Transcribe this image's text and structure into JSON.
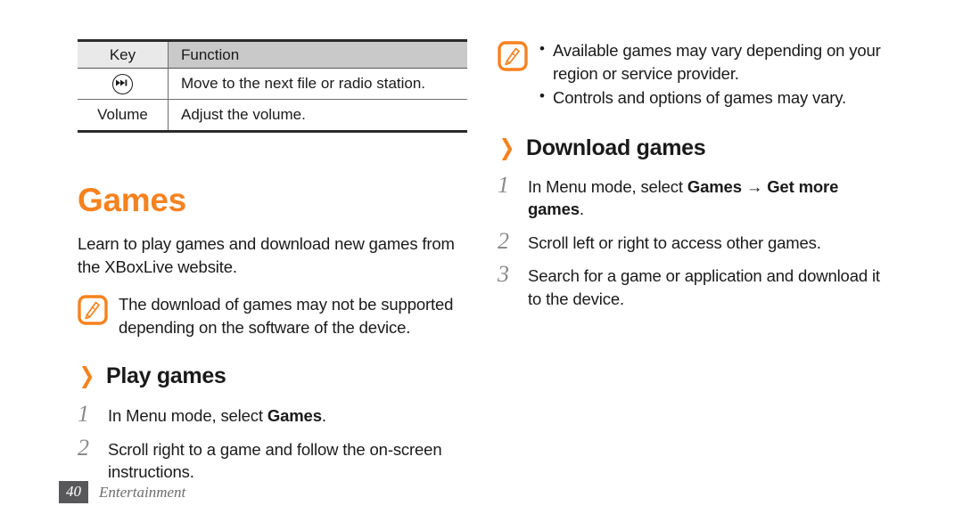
{
  "table": {
    "headers": [
      "Key",
      "Function"
    ],
    "rows": [
      {
        "key_icon": "next-track-icon",
        "key": "",
        "function": "Move to the next file or radio station."
      },
      {
        "key_icon": "",
        "key": "Volume",
        "function": "Adjust the volume."
      }
    ]
  },
  "left": {
    "title": "Games",
    "intro": "Learn to play games and download new games from the XBoxLive website.",
    "note": {
      "icon": "note-pen-icon",
      "text": "The download of games may not be supported depending on the software of the device."
    },
    "section": {
      "chevron": "❯",
      "heading": "Play games",
      "steps": [
        {
          "num": "1",
          "pre": "In Menu mode, select ",
          "bold": "Games",
          "post": "."
        },
        {
          "num": "2",
          "pre": "Scroll right to a game and follow the on-screen instructions.",
          "bold": "",
          "post": ""
        }
      ]
    }
  },
  "right": {
    "note": {
      "icon": "note-pen-icon",
      "bullets": [
        "Available games may vary depending on your region or service provider.",
        "Controls and options of games may vary."
      ]
    },
    "section": {
      "chevron": "❯",
      "heading": "Download games",
      "steps": [
        {
          "num": "1",
          "pre": "In Menu mode, select ",
          "bold": "Games",
          "mid": " → ",
          "bold2": "Get more games",
          "post": "."
        },
        {
          "num": "2",
          "pre": "Scroll left or right to access other games.",
          "bold": "",
          "post": ""
        },
        {
          "num": "3",
          "pre": "Search for a game or application and download it to the device.",
          "bold": "",
          "post": ""
        }
      ]
    }
  },
  "footer": {
    "page": "40",
    "label": "Entertainment"
  },
  "colors": {
    "accent_orange": "#F5821F",
    "header_key_bg": "#E9E9E9",
    "header_fn_bg": "#C9C9C9",
    "rule_dark": "#2B2B2B",
    "step_num_gray": "#8A8A8A",
    "footer_box": "#58585A"
  }
}
